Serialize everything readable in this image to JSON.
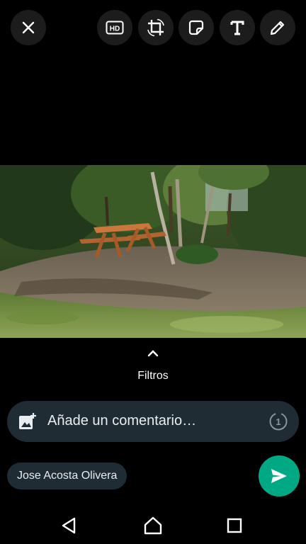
{
  "toolbar": {
    "close_icon": "close-icon",
    "hd_label": "HD",
    "crop_icon": "crop-rotate-icon",
    "sticker_icon": "sticker-icon",
    "text_icon": "text-icon",
    "pencil_icon": "pencil-icon"
  },
  "filters": {
    "label": "Filtros",
    "icon": "chevron-up-icon"
  },
  "comment": {
    "placeholder": "Añade un comentario…",
    "add_media_icon": "add-photo-icon",
    "view_once_label": "1"
  },
  "recipient": {
    "name": "Jose Acosta Olivera"
  },
  "send": {
    "icon": "send-icon",
    "color": "#00a884"
  },
  "navigation": {
    "back_icon": "back-triangle-icon",
    "home_icon": "home-icon",
    "recents_icon": "recents-square-icon"
  },
  "colors": {
    "background": "#000000",
    "button_bg": "#1c1c1c",
    "input_bg": "#1f2c34",
    "accent": "#00a884"
  }
}
